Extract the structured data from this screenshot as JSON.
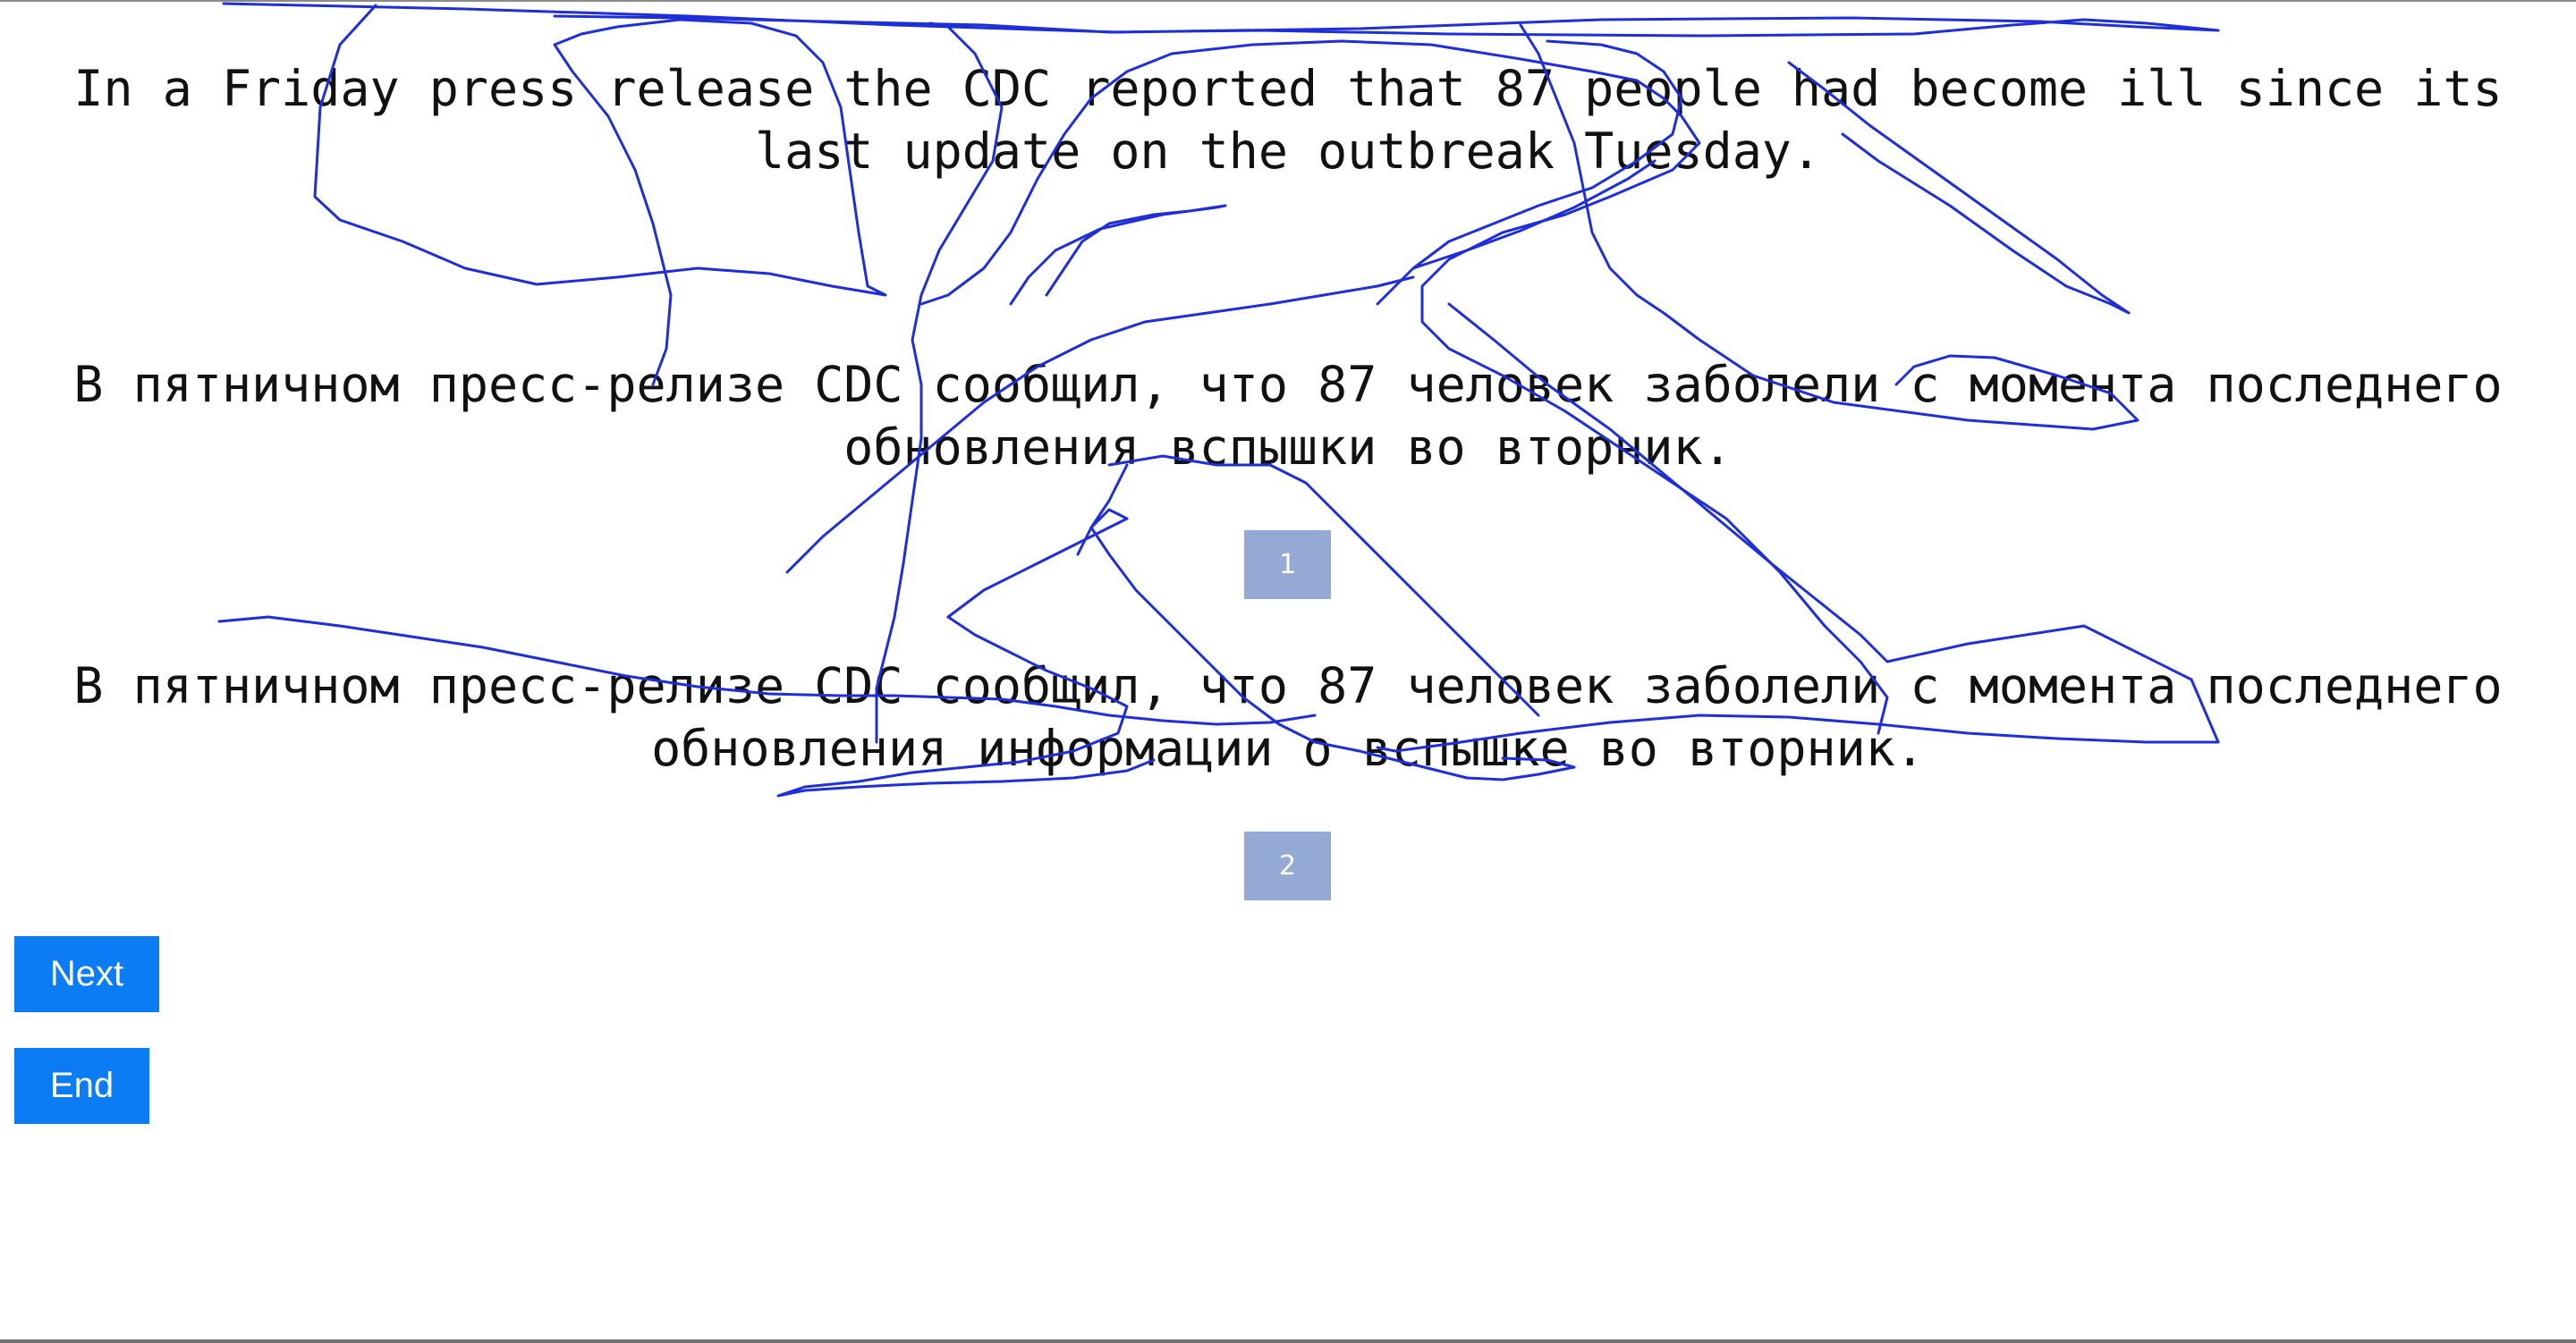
{
  "sentences": {
    "source": "In a Friday press release the CDC reported that 87 people had become ill since its last update on the outbreak Tuesday.",
    "translation_1": "В пятничном пресс-релизе CDC сообщил, что 87 человек заболели с момента последнего обновления вспышки во вторник.",
    "translation_2": "В пятничном пресс-релизе CDC сообщил, что 87 человек заболели с момента последнего обновления информации о вспышке во вторник."
  },
  "badges": {
    "rank_1": "1",
    "rank_2": "2"
  },
  "buttons": {
    "next_label": "Next",
    "end_label": "End"
  },
  "colors": {
    "button_bg": "#0c7cf5",
    "badge_bg": "#94a9d3",
    "scribble_stroke": "#1f2fd8"
  }
}
